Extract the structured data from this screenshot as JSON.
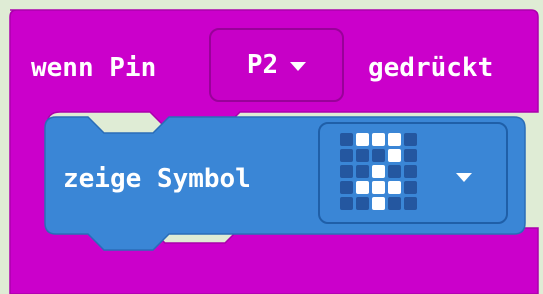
{
  "event_block": {
    "label_prefix": "wenn Pin",
    "pin_selected": "P2",
    "label_suffix": "gedrückt",
    "color": "#cb00cb"
  },
  "statement_block": {
    "label": "zeige Symbol",
    "color": "#3a86d6",
    "icon_leds": [
      [
        0,
        1,
        1,
        1,
        0
      ],
      [
        0,
        0,
        0,
        1,
        0
      ],
      [
        0,
        0,
        1,
        0,
        0
      ],
      [
        0,
        1,
        1,
        1,
        0
      ],
      [
        0,
        0,
        1,
        0,
        0
      ]
    ]
  },
  "icons": {
    "pin_dropdown_caret": "caret-down-icon",
    "symbol_dropdown_caret": "caret-down-icon"
  }
}
